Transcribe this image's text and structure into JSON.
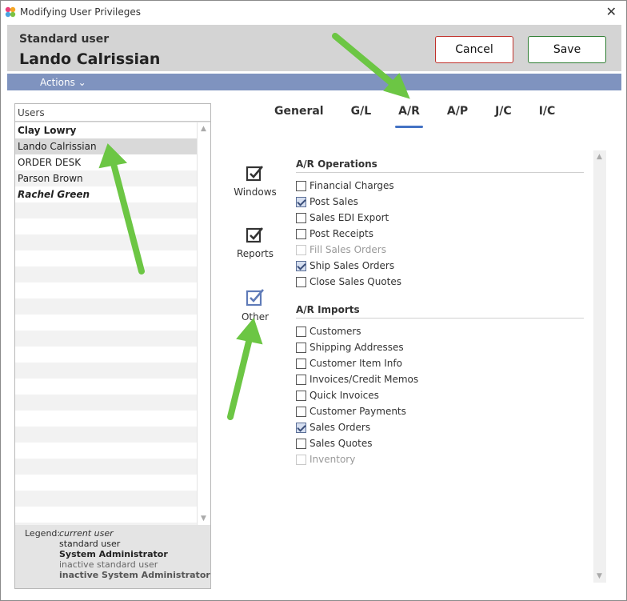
{
  "window": {
    "title": "Modifying User Privileges",
    "close_glyph": "✕"
  },
  "header": {
    "user_type": "Standard user",
    "user_name": "Lando Calrissian",
    "cancel_label": "Cancel",
    "save_label": "Save",
    "cancel_color": "#c0302a",
    "save_color": "#2e7d32"
  },
  "actions": {
    "label": "Actions ⌄"
  },
  "users": {
    "header": "Users",
    "items": [
      {
        "name": "Clay Lowry",
        "style": "current user"
      },
      {
        "name": "Lando Calrissian",
        "style": "standard user",
        "selected": true
      },
      {
        "name": "ORDER DESK",
        "style": "standard user"
      },
      {
        "name": "Parson Brown",
        "style": "standard user"
      },
      {
        "name": "Rachel Green",
        "style": "System Administrator"
      }
    ],
    "legend": {
      "label": "Legend:",
      "items": [
        "current user",
        "standard user",
        "System Administrator",
        "inactive standard user",
        "inactive System Administrator"
      ]
    }
  },
  "tabs": [
    {
      "label": "General",
      "active": false
    },
    {
      "label": "G/L",
      "active": false
    },
    {
      "label": "A/R",
      "active": true
    },
    {
      "label": "A/P",
      "active": false
    },
    {
      "label": "J/C",
      "active": false
    },
    {
      "label": "I/C",
      "active": false
    }
  ],
  "side_nav": [
    {
      "label": "Windows",
      "icon": "checkbox-icon"
    },
    {
      "label": "Reports",
      "icon": "checkbox-icon"
    },
    {
      "label": "Other",
      "icon": "checkbox-icon",
      "active": true
    }
  ],
  "accent_color": "#4472c4",
  "permissions": {
    "operations": {
      "title": "A/R Operations",
      "items": [
        {
          "label": "Financial Charges",
          "checked": false,
          "enabled": true
        },
        {
          "label": "Post Sales",
          "checked": true,
          "enabled": true
        },
        {
          "label": "Sales EDI Export",
          "checked": false,
          "enabled": true
        },
        {
          "label": "Post Receipts",
          "checked": false,
          "enabled": true
        },
        {
          "label": "Fill Sales Orders",
          "checked": false,
          "enabled": false
        },
        {
          "label": "Ship Sales Orders",
          "checked": true,
          "enabled": true
        },
        {
          "label": "Close Sales Quotes",
          "checked": false,
          "enabled": true
        }
      ]
    },
    "imports": {
      "title": "A/R Imports",
      "items": [
        {
          "label": "Customers",
          "checked": false,
          "enabled": true
        },
        {
          "label": "Shipping Addresses",
          "checked": false,
          "enabled": true
        },
        {
          "label": "Customer Item Info",
          "checked": false,
          "enabled": true
        },
        {
          "label": "Invoices/Credit Memos",
          "checked": false,
          "enabled": true
        },
        {
          "label": "Quick Invoices",
          "checked": false,
          "enabled": true
        },
        {
          "label": "Customer Payments",
          "checked": false,
          "enabled": true
        },
        {
          "label": "Sales Orders",
          "checked": true,
          "enabled": true
        },
        {
          "label": "Sales Quotes",
          "checked": false,
          "enabled": true
        },
        {
          "label": "Inventory",
          "checked": false,
          "enabled": false
        }
      ]
    }
  }
}
